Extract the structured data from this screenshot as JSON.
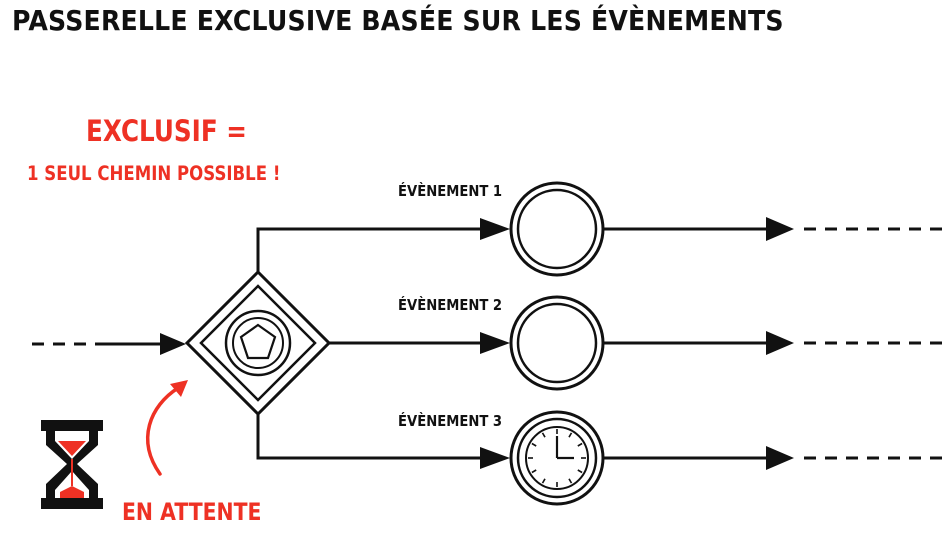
{
  "title": "PASSERELLE EXCLUSIVE BASÉE SUR LES ÉVÈNEMENTS",
  "note": {
    "line1": "EXCLUSIF =",
    "line2": "1 SEUL CHEMIN POSSIBLE !",
    "waiting": "EN ATTENTE"
  },
  "events": [
    {
      "label": "ÉVÈNEMENT 1",
      "type": "intermediate-event"
    },
    {
      "label": "ÉVÈNEMENT 2",
      "type": "intermediate-event"
    },
    {
      "label": "ÉVÈNEMENT 3",
      "type": "timer-event"
    }
  ],
  "gateway": {
    "type": "event-based-exclusive-gateway",
    "icon": "pentagon-icon"
  },
  "icons": [
    "hourglass-icon",
    "curved-arrow-icon",
    "clock-icon"
  ],
  "colors": {
    "accent": "#ee3124",
    "ink": "#111111",
    "background": "#ffffff"
  }
}
